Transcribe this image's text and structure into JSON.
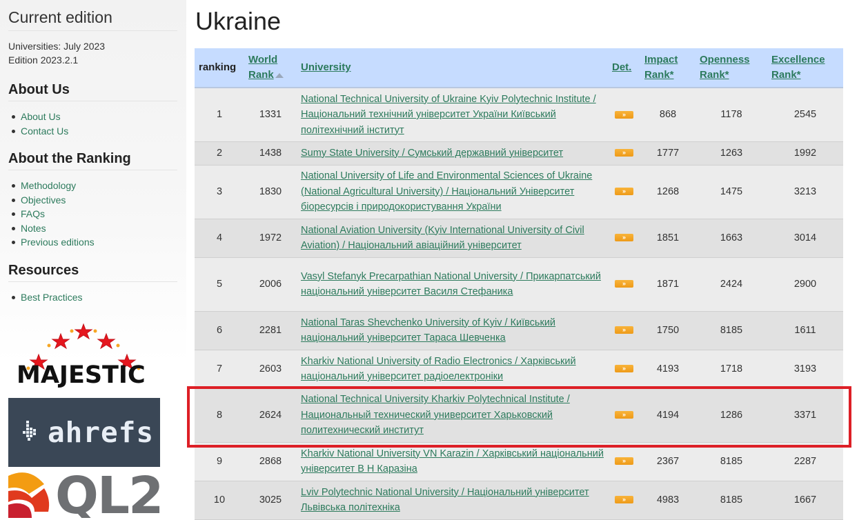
{
  "sidebar": {
    "current_edition_title": "Current edition",
    "edition_lines": [
      "Universities: July 2023",
      "Edition 2023.2.1"
    ],
    "about_us_title": "About Us",
    "about_us_links": [
      "About Us",
      "Contact Us"
    ],
    "about_ranking_title": "About the Ranking",
    "about_ranking_links": [
      "Methodology",
      "Objectives",
      "FAQs",
      "Notes",
      "Previous editions"
    ],
    "resources_title": "Resources",
    "resources_links": [
      "Best Practices"
    ],
    "logos": [
      "MAJESTIC",
      "ahrefs",
      "QL2"
    ]
  },
  "page_title": "Ukraine",
  "table": {
    "headers": {
      "ranking": "ranking",
      "world_rank_line1": "World",
      "world_rank_line2": "Rank",
      "university": "University",
      "det": "Det.",
      "impact_line1": "Impact",
      "impact_line2": "Rank*",
      "openness_line1": "Openness",
      "openness_line2": "Rank*",
      "excellence_line1": "Excellence",
      "excellence_line2": "Rank*"
    },
    "det_button_label": "»",
    "rows": [
      {
        "ranking": "1",
        "world_rank": "1331",
        "university": "National Technical University of Ukraine Kyiv Polytechnic Institute / Національний технічний університет України Київський політехнічний інститут",
        "impact": "868",
        "openness": "1178",
        "excellence": "2545"
      },
      {
        "ranking": "2",
        "world_rank": "1438",
        "university": "Sumy State University / Сумський державний університет",
        "impact": "1777",
        "openness": "1263",
        "excellence": "1992"
      },
      {
        "ranking": "3",
        "world_rank": "1830",
        "university": "National University of Life and Environmental Sciences of Ukraine (National Agricultural University) / Національний Університет біоресурсів і природокористування України",
        "impact": "1268",
        "openness": "1475",
        "excellence": "3213"
      },
      {
        "ranking": "4",
        "world_rank": "1972",
        "university": "National Aviation University (Kyiv International University of Civil Aviation) / Національний авіаційний університет",
        "impact": "1851",
        "openness": "1663",
        "excellence": "3014"
      },
      {
        "ranking": "5",
        "world_rank": "2006",
        "university": "Vasyl Stefanyk Precarpathian National University / Прикарпатський національний університет Василя Стефаника",
        "impact": "1871",
        "openness": "2424",
        "excellence": "2900"
      },
      {
        "ranking": "6",
        "world_rank": "2281",
        "university": "National Taras Shevchenko University of Kyiv / Київський національний університет Тараса Шевченка",
        "impact": "1750",
        "openness": "8185",
        "excellence": "1611"
      },
      {
        "ranking": "7",
        "world_rank": "2603",
        "university": "Kharkiv National University of Radio Electronics / Харківський національний університет радіоелектроніки",
        "impact": "4193",
        "openness": "1718",
        "excellence": "3193"
      },
      {
        "ranking": "8",
        "world_rank": "2624",
        "university": "National Technical University Kharkiv Polytechnical Institute / Национальный технический университет Харьковский политехнический институт",
        "impact": "4194",
        "openness": "1286",
        "excellence": "3371"
      },
      {
        "ranking": "9",
        "world_rank": "2868",
        "university": "Kharkiv National University VN Karazin / Харківський національний університет В Н Каразіна",
        "impact": "2367",
        "openness": "8185",
        "excellence": "2287"
      },
      {
        "ranking": "10",
        "world_rank": "3025",
        "university": "Lviv Polytechnic National University / Національний університет Львівська політехніка",
        "impact": "4983",
        "openness": "8185",
        "excellence": "1667"
      }
    ]
  },
  "colors": {
    "link": "#2c7a5c",
    "header_bg": "#c6dcff",
    "highlight": "#dd1f26",
    "det_button": "#f2a324"
  }
}
